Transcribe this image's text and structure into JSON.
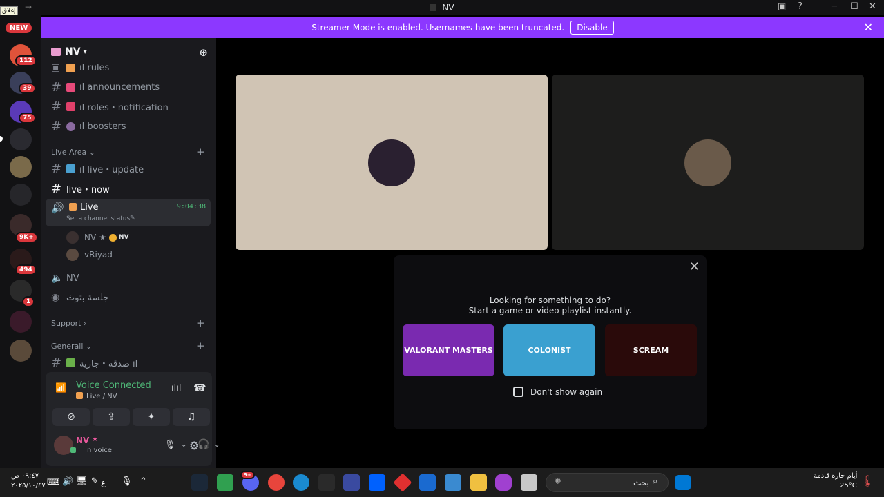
{
  "titlebar": {
    "close_tag": "إغلاق",
    "title": "NV"
  },
  "streamer": {
    "message": "Streamer Mode is enabled. Usernames have been truncated.",
    "disable_label": "Disable"
  },
  "rail": {
    "new_label": "NEW",
    "badges": [
      "112",
      "39",
      "75",
      "9K+",
      "494",
      "1"
    ]
  },
  "guild": {
    "name": "NV"
  },
  "channels": {
    "rules": "ıl rules",
    "announcements": "ıl announcements",
    "roles": "ıl roles・notification",
    "boosters": "ıl boosters",
    "cat_live": "Live Area",
    "live_update": "ıl live・update",
    "live_now": "live・now",
    "voice_live": "Live",
    "voice_timer": "9:04:38",
    "voice_status": "Set a channel status",
    "user1": "NV",
    "user1_tag": "NV",
    "user2": "vRiyad",
    "voice_nv": "NV",
    "stage": "جلسة بثوث",
    "cat_support": "Support",
    "cat_general": "Generall",
    "sadaqa": "صدقه・جارية ıl"
  },
  "voice_panel": {
    "title": "Voice Connected",
    "subtitle": "Live / NV",
    "me_name": "NV",
    "me_status": "In voice"
  },
  "activity": {
    "headline1": "Looking for something to do?",
    "headline2": "Start a game or video playlist instantly.",
    "games": [
      "VALORANT MASTERS",
      "COLONIST",
      "SCREAM"
    ],
    "dont_show": "Don't show again"
  },
  "taskbar": {
    "time": "٠٩:٤٧ ص",
    "date": "٢٠٢٥/١٠/٤٧",
    "lang": "ع",
    "search_placeholder": "بحث",
    "weather_line1": "أيام حارة قادمة",
    "weather_line2": "25°C",
    "discord_badge": "9+"
  },
  "colors": {
    "accent": "#8c38ff",
    "voice_green": "#4fb978",
    "badge_red": "#da373c"
  }
}
